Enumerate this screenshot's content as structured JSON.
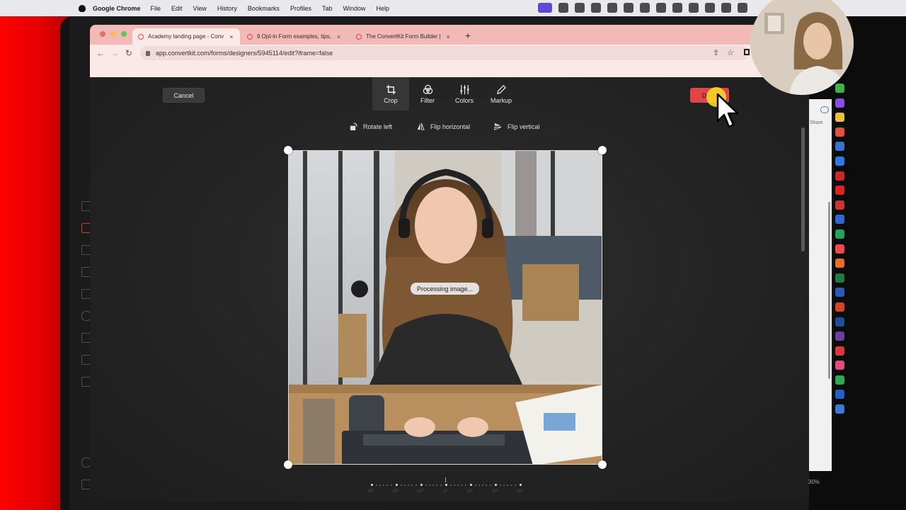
{
  "menubar": {
    "app": "Google Chrome",
    "items": [
      "File",
      "Edit",
      "View",
      "History",
      "Bookmarks",
      "Profiles",
      "Tab",
      "Window",
      "Help"
    ]
  },
  "browser": {
    "tabs": [
      {
        "title": "Academy landing page - Conv",
        "close": "×"
      },
      {
        "title": "9 Opt-in Form examples, tips,",
        "close": "×"
      },
      {
        "title": "The ConvertKit Form Builder |",
        "close": "×"
      }
    ],
    "new_tab": "+",
    "url": "app.convertkit.com/forms/designers/5945114/edit?iframe=false"
  },
  "editor": {
    "cancel_label": "Cancel",
    "done_label": "Done",
    "tools": [
      {
        "label": "Crop",
        "icon": "crop-icon"
      },
      {
        "label": "Filter",
        "icon": "filter-icon"
      },
      {
        "label": "Colors",
        "icon": "sliders-icon"
      },
      {
        "label": "Markup",
        "icon": "pencil-icon"
      }
    ],
    "subtools": [
      {
        "label": "Rotate left",
        "icon": "rotate-left-icon"
      },
      {
        "label": "Flip horizontal",
        "icon": "flip-horizontal-icon"
      },
      {
        "label": "Flip vertical",
        "icon": "flip-vertical-icon"
      }
    ],
    "processing_text": "Processing image...",
    "ruler_labels": [
      "-30°",
      "-20°",
      "-10°",
      "0°",
      "10°",
      "20°",
      "30°"
    ]
  },
  "right_panel": {
    "share_label": "Share",
    "zoom": "30%"
  },
  "colors": {
    "done": "#e24448",
    "tabstrip": "#f3b9b6",
    "accent_red": "#ff0000"
  }
}
